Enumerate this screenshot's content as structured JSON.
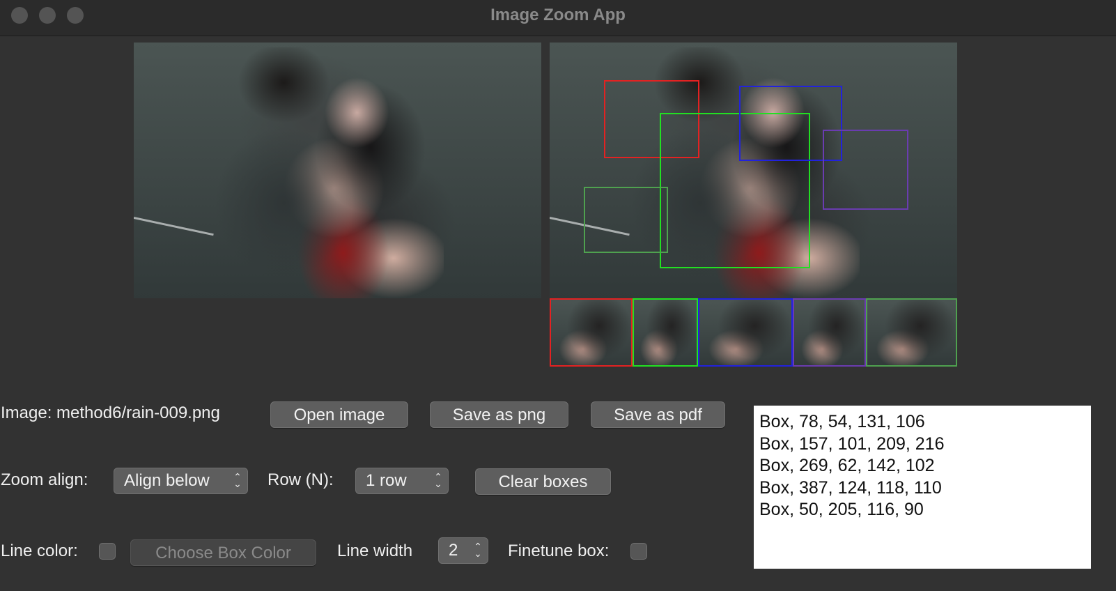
{
  "window": {
    "title": "Image Zoom App"
  },
  "file": {
    "label": "Image: method6/rain-009.png"
  },
  "buttons": {
    "open": "Open image",
    "save_png": "Save as png",
    "save_pdf": "Save as pdf",
    "clear": "Clear boxes",
    "choose_color": "Choose Box Color"
  },
  "zoom_align": {
    "label": "Zoom align:",
    "value": "Align below"
  },
  "rows": {
    "label": "Row (N):",
    "value": "1 row"
  },
  "line_color": {
    "label": "Line color:",
    "checked": false
  },
  "line_width": {
    "label": "Line width",
    "value": "2"
  },
  "finetune": {
    "label": "Finetune box:",
    "checked": false
  },
  "boxes_text": [
    "Box, 78, 54, 131, 106",
    "Box, 157, 101, 209, 216",
    "Box, 269, 62, 142, 102",
    "Box, 387, 124, 118, 110",
    "Box, 50, 205, 116, 90"
  ],
  "box_colors": [
    "#e32222",
    "#22e022",
    "#2222dd",
    "#6a3cb0",
    "#4fa14f"
  ]
}
